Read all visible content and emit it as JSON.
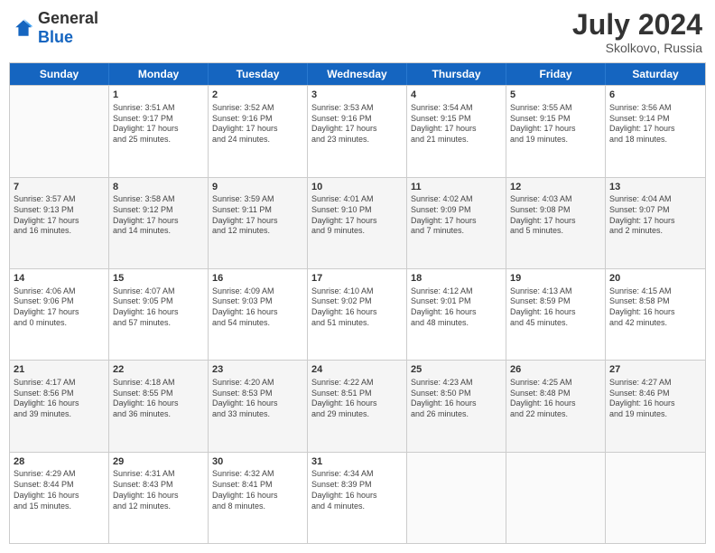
{
  "header": {
    "logo_general": "General",
    "logo_blue": "Blue",
    "month_year": "July 2024",
    "location": "Skolkovo, Russia"
  },
  "days_of_week": [
    "Sunday",
    "Monday",
    "Tuesday",
    "Wednesday",
    "Thursday",
    "Friday",
    "Saturday"
  ],
  "rows": [
    {
      "shaded": false,
      "cells": [
        {
          "day": "",
          "info": ""
        },
        {
          "day": "1",
          "info": "Sunrise: 3:51 AM\nSunset: 9:17 PM\nDaylight: 17 hours\nand 25 minutes."
        },
        {
          "day": "2",
          "info": "Sunrise: 3:52 AM\nSunset: 9:16 PM\nDaylight: 17 hours\nand 24 minutes."
        },
        {
          "day": "3",
          "info": "Sunrise: 3:53 AM\nSunset: 9:16 PM\nDaylight: 17 hours\nand 23 minutes."
        },
        {
          "day": "4",
          "info": "Sunrise: 3:54 AM\nSunset: 9:15 PM\nDaylight: 17 hours\nand 21 minutes."
        },
        {
          "day": "5",
          "info": "Sunrise: 3:55 AM\nSunset: 9:15 PM\nDaylight: 17 hours\nand 19 minutes."
        },
        {
          "day": "6",
          "info": "Sunrise: 3:56 AM\nSunset: 9:14 PM\nDaylight: 17 hours\nand 18 minutes."
        }
      ]
    },
    {
      "shaded": true,
      "cells": [
        {
          "day": "7",
          "info": "Sunrise: 3:57 AM\nSunset: 9:13 PM\nDaylight: 17 hours\nand 16 minutes."
        },
        {
          "day": "8",
          "info": "Sunrise: 3:58 AM\nSunset: 9:12 PM\nDaylight: 17 hours\nand 14 minutes."
        },
        {
          "day": "9",
          "info": "Sunrise: 3:59 AM\nSunset: 9:11 PM\nDaylight: 17 hours\nand 12 minutes."
        },
        {
          "day": "10",
          "info": "Sunrise: 4:01 AM\nSunset: 9:10 PM\nDaylight: 17 hours\nand 9 minutes."
        },
        {
          "day": "11",
          "info": "Sunrise: 4:02 AM\nSunset: 9:09 PM\nDaylight: 17 hours\nand 7 minutes."
        },
        {
          "day": "12",
          "info": "Sunrise: 4:03 AM\nSunset: 9:08 PM\nDaylight: 17 hours\nand 5 minutes."
        },
        {
          "day": "13",
          "info": "Sunrise: 4:04 AM\nSunset: 9:07 PM\nDaylight: 17 hours\nand 2 minutes."
        }
      ]
    },
    {
      "shaded": false,
      "cells": [
        {
          "day": "14",
          "info": "Sunrise: 4:06 AM\nSunset: 9:06 PM\nDaylight: 17 hours\nand 0 minutes."
        },
        {
          "day": "15",
          "info": "Sunrise: 4:07 AM\nSunset: 9:05 PM\nDaylight: 16 hours\nand 57 minutes."
        },
        {
          "day": "16",
          "info": "Sunrise: 4:09 AM\nSunset: 9:03 PM\nDaylight: 16 hours\nand 54 minutes."
        },
        {
          "day": "17",
          "info": "Sunrise: 4:10 AM\nSunset: 9:02 PM\nDaylight: 16 hours\nand 51 minutes."
        },
        {
          "day": "18",
          "info": "Sunrise: 4:12 AM\nSunset: 9:01 PM\nDaylight: 16 hours\nand 48 minutes."
        },
        {
          "day": "19",
          "info": "Sunrise: 4:13 AM\nSunset: 8:59 PM\nDaylight: 16 hours\nand 45 minutes."
        },
        {
          "day": "20",
          "info": "Sunrise: 4:15 AM\nSunset: 8:58 PM\nDaylight: 16 hours\nand 42 minutes."
        }
      ]
    },
    {
      "shaded": true,
      "cells": [
        {
          "day": "21",
          "info": "Sunrise: 4:17 AM\nSunset: 8:56 PM\nDaylight: 16 hours\nand 39 minutes."
        },
        {
          "day": "22",
          "info": "Sunrise: 4:18 AM\nSunset: 8:55 PM\nDaylight: 16 hours\nand 36 minutes."
        },
        {
          "day": "23",
          "info": "Sunrise: 4:20 AM\nSunset: 8:53 PM\nDaylight: 16 hours\nand 33 minutes."
        },
        {
          "day": "24",
          "info": "Sunrise: 4:22 AM\nSunset: 8:51 PM\nDaylight: 16 hours\nand 29 minutes."
        },
        {
          "day": "25",
          "info": "Sunrise: 4:23 AM\nSunset: 8:50 PM\nDaylight: 16 hours\nand 26 minutes."
        },
        {
          "day": "26",
          "info": "Sunrise: 4:25 AM\nSunset: 8:48 PM\nDaylight: 16 hours\nand 22 minutes."
        },
        {
          "day": "27",
          "info": "Sunrise: 4:27 AM\nSunset: 8:46 PM\nDaylight: 16 hours\nand 19 minutes."
        }
      ]
    },
    {
      "shaded": false,
      "cells": [
        {
          "day": "28",
          "info": "Sunrise: 4:29 AM\nSunset: 8:44 PM\nDaylight: 16 hours\nand 15 minutes."
        },
        {
          "day": "29",
          "info": "Sunrise: 4:31 AM\nSunset: 8:43 PM\nDaylight: 16 hours\nand 12 minutes."
        },
        {
          "day": "30",
          "info": "Sunrise: 4:32 AM\nSunset: 8:41 PM\nDaylight: 16 hours\nand 8 minutes."
        },
        {
          "day": "31",
          "info": "Sunrise: 4:34 AM\nSunset: 8:39 PM\nDaylight: 16 hours\nand 4 minutes."
        },
        {
          "day": "",
          "info": ""
        },
        {
          "day": "",
          "info": ""
        },
        {
          "day": "",
          "info": ""
        }
      ]
    }
  ]
}
